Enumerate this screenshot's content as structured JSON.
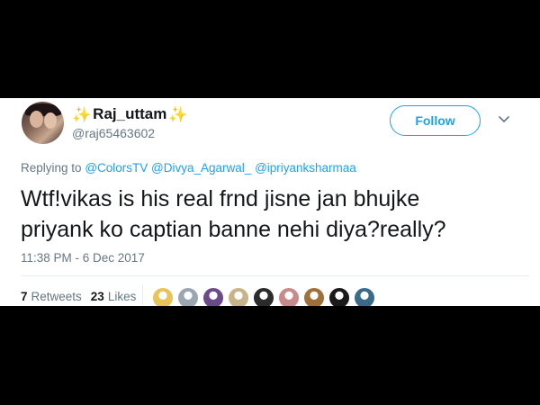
{
  "tweet": {
    "display_name": "Raj_uttam",
    "sparkle_glyph": "✨",
    "handle": "@raj65463602",
    "follow_label": "Follow",
    "replying_prefix": "Replying to",
    "mentions": [
      "@ColorsTV",
      "@Divya_Agarwal_",
      "@ipriyanksharmaa"
    ],
    "text_line1": "Wtf!vikas is his real frnd jisne jan bhujke",
    "text_line2": "priyank ko captian banne nehi diya?really?",
    "timestamp": "11:38 PM - 6 Dec 2017",
    "retweets_count": "7",
    "retweets_label": "Retweets",
    "likes_count": "23",
    "likes_label": "Likes",
    "likers": [
      {
        "color": "#e8c35a",
        "icon": "avatar-photo"
      },
      {
        "color": "#9aa7b0",
        "icon": "avatar-default"
      },
      {
        "color": "#6b4a8a",
        "icon": "avatar-photo"
      },
      {
        "color": "#c9b48a",
        "icon": "avatar-photo"
      },
      {
        "color": "#2b2b2b",
        "icon": "avatar-photo"
      },
      {
        "color": "#c98a8a",
        "icon": "avatar-photo"
      },
      {
        "color": "#a0703a",
        "icon": "avatar-photo"
      },
      {
        "color": "#1a1a1a",
        "icon": "avatar-photo"
      },
      {
        "color": "#3a6a8a",
        "icon": "avatar-photo"
      }
    ]
  },
  "colors": {
    "accent": "#1da1f2",
    "secondary_text": "#657786",
    "primary_text": "#14171a"
  }
}
